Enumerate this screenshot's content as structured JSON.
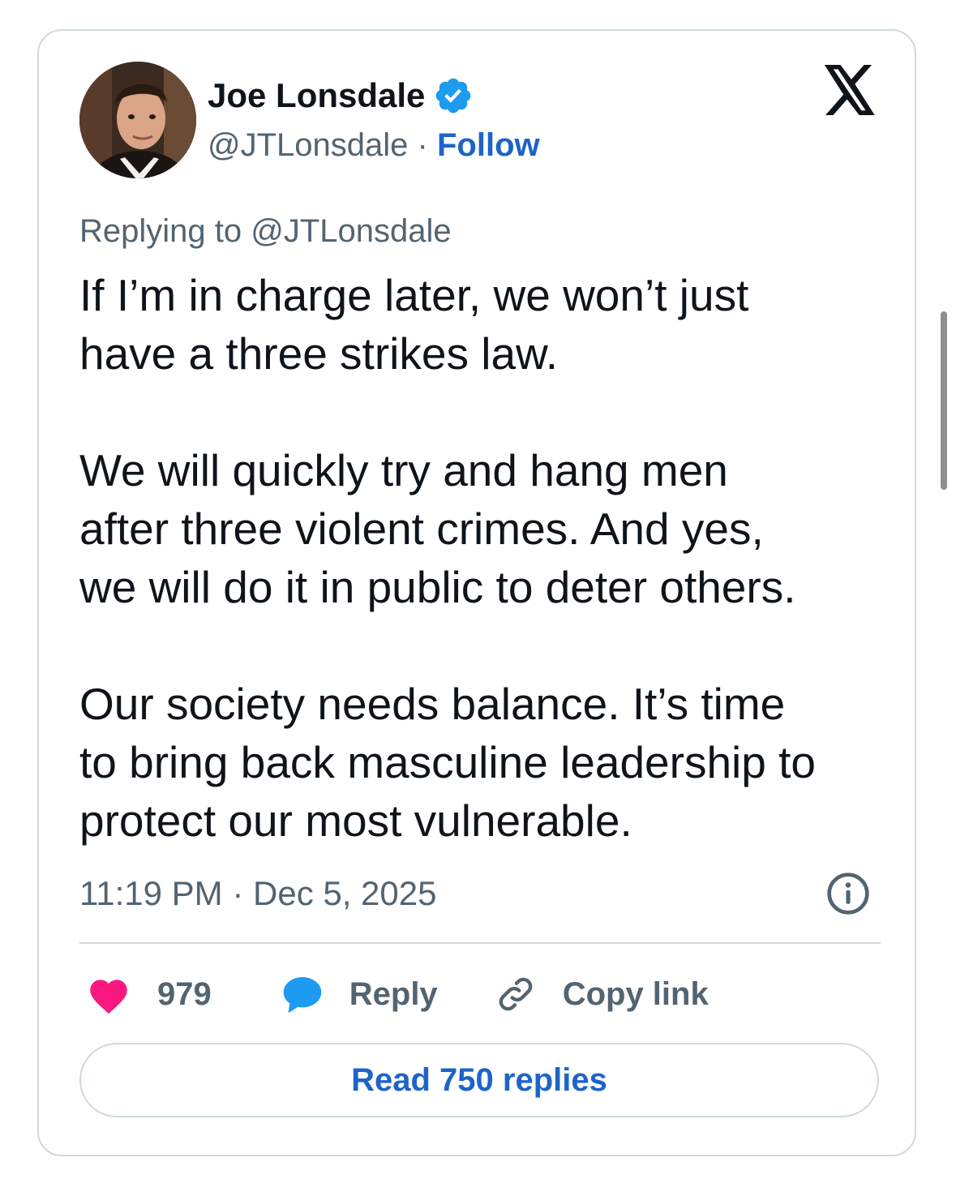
{
  "author": {
    "name": "Joe Lonsdale",
    "handle": "@JTLonsdale",
    "separator": "·",
    "follow_label": "Follow",
    "verified": true
  },
  "brand": {
    "logo_icon": "x-logo-icon",
    "accent_color": "#1d9bf0",
    "link_color": "#1d64c8"
  },
  "tweet": {
    "replying_prefix": "Replying to",
    "replying_handle": "@JTLonsdale",
    "paragraphs": [
      "If I’m in charge later, we won’t just\nhave a three strikes law.",
      "We will quickly try and hang men\nafter three violent crimes. And yes,\nwe will do it in public to deter others.",
      "Our society needs balance. It’s time\nto bring back masculine leadership to\nprotect our most vulnerable."
    ],
    "time": "11:19 PM",
    "meta_separator": "·",
    "date": "Dec 5, 2025"
  },
  "actions": {
    "like_count": "979",
    "like_color": "#f91880",
    "reply_label": "Reply",
    "reply_color": "#1d9bf0",
    "copy_label": "Copy link",
    "read_replies_label": "Read 750 replies"
  }
}
